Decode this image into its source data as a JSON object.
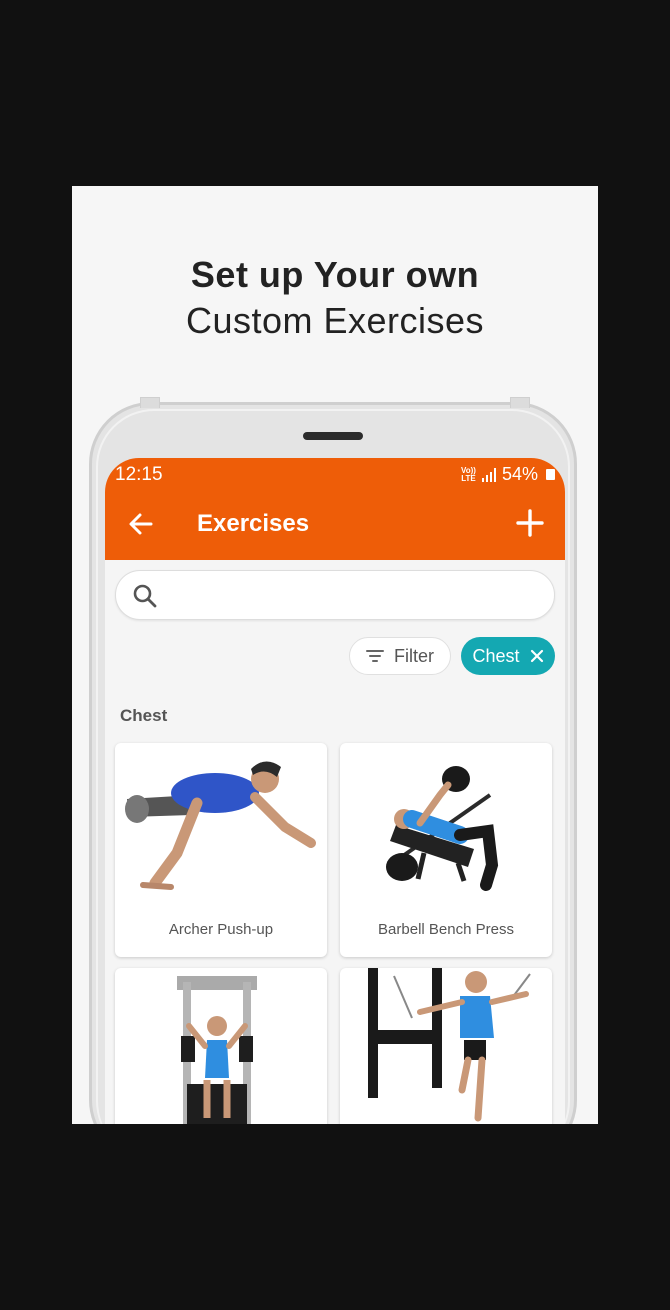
{
  "promo": {
    "line1": "Set up Your own",
    "line2": "Custom Exercises"
  },
  "status_bar": {
    "time": "12:15",
    "network_top": "Vo))",
    "network_bottom": "LTE",
    "battery": "54%"
  },
  "app_bar": {
    "title": "Exercises",
    "back_icon": "arrow-left-icon",
    "add_icon": "plus-icon"
  },
  "search": {
    "placeholder": "",
    "icon": "search-icon"
  },
  "filters": {
    "filter_label": "Filter",
    "active_chip": "Chest"
  },
  "section": {
    "label": "Chest"
  },
  "exercises": [
    {
      "name": "Archer Push-up"
    },
    {
      "name": "Barbell Bench Press"
    },
    {
      "name": ""
    },
    {
      "name": ""
    }
  ],
  "colors": {
    "app_bar": "#ee5d08",
    "chip": "#14a8b2",
    "background": "#111111"
  }
}
